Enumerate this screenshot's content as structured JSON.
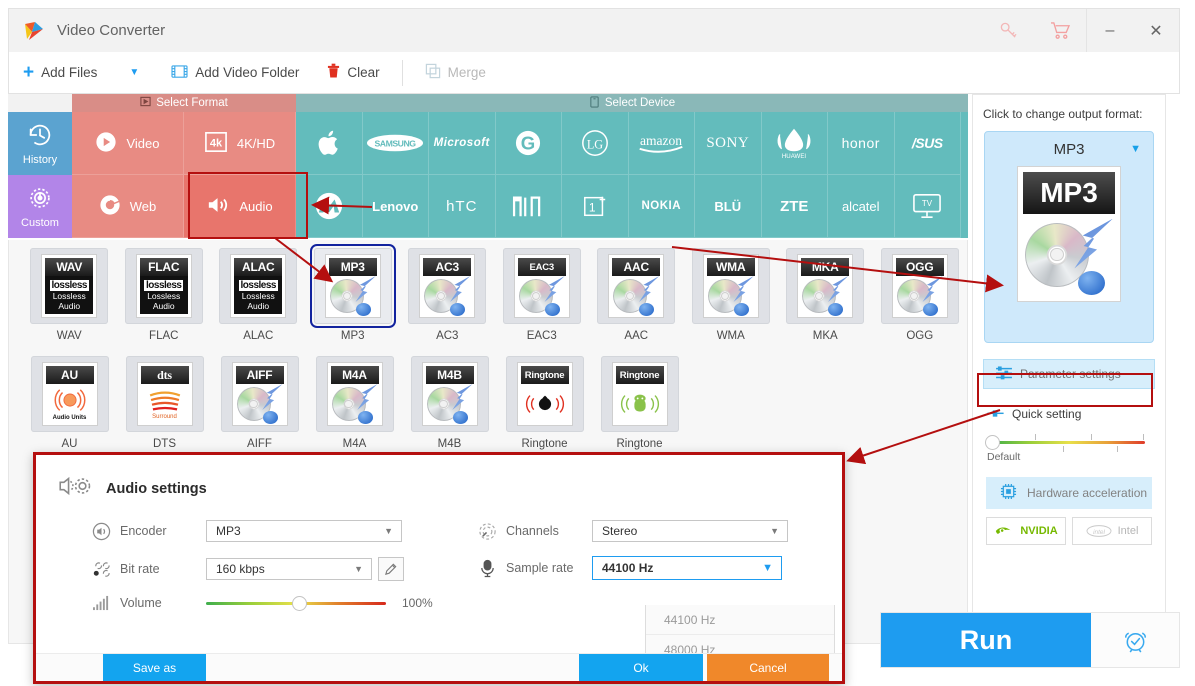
{
  "window": {
    "title": "Video Converter",
    "logo_icon": "app-logo-icon",
    "key_icon": "key-icon",
    "cart_icon": "cart-icon",
    "minimize": "–",
    "close": "✕"
  },
  "toolbar": {
    "add_files": "Add Files",
    "add_files_caret": "▼",
    "add_video_folder": "Add Video Folder",
    "clear": "Clear",
    "merge": "Merge"
  },
  "strip": {
    "select_format_header": "Select Format",
    "select_device_header": "Select Device",
    "side_tabs": [
      {
        "label": "History",
        "icon": "history-icon",
        "color": "#5ba3d0"
      },
      {
        "label": "Custom",
        "icon": "gear-icon",
        "color": "#b285e8"
      }
    ],
    "format_tabs": [
      {
        "label": "Video",
        "icon": "play-circle-icon",
        "selected": false
      },
      {
        "label": "4K/HD",
        "icon": "4k-icon",
        "selected": false
      },
      {
        "label": "Web",
        "icon": "chrome-icon",
        "selected": false
      },
      {
        "label": "Audio",
        "icon": "speaker-icon",
        "selected": true
      }
    ],
    "devices": [
      "Apple",
      "SAMSUNG",
      "Microsoft",
      "G",
      "LG",
      "amazon",
      "SONY",
      "HUAWEI",
      "honor",
      "/SUS",
      "Motorola",
      "Lenovo",
      "hTC",
      "MI",
      "1+",
      "NOKIA",
      "BLU",
      "ZTE",
      "alcatel",
      "TV"
    ]
  },
  "formats": {
    "row1": [
      {
        "name": "WAV",
        "badge": "WAV",
        "type": "lossless",
        "selected": false
      },
      {
        "name": "FLAC",
        "badge": "FLAC",
        "type": "lossless",
        "selected": false
      },
      {
        "name": "ALAC",
        "badge": "ALAC",
        "type": "lossless",
        "selected": false
      },
      {
        "name": "MP3",
        "badge": "MP3",
        "type": "cd",
        "selected": true
      },
      {
        "name": "AC3",
        "badge": "AC3",
        "type": "cd",
        "selected": false
      },
      {
        "name": "EAC3",
        "badge": "EAC3",
        "type": "cd",
        "selected": false
      },
      {
        "name": "AAC",
        "badge": "AAC",
        "type": "cd",
        "selected": false
      },
      {
        "name": "WMA",
        "badge": "WMA",
        "type": "cd",
        "selected": false
      },
      {
        "name": "MKA",
        "badge": "MKA",
        "type": "cd",
        "selected": false
      },
      {
        "name": "OGG",
        "badge": "OGG",
        "type": "cd",
        "selected": false
      }
    ],
    "row2": [
      {
        "name": "AU",
        "badge": "AU",
        "type": "au",
        "sub": "Audio Units"
      },
      {
        "name": "DTS",
        "badge": "dts",
        "type": "dts",
        "sub": "Surround"
      },
      {
        "name": "AIFF",
        "badge": "AIFF",
        "type": "cd",
        "sub": ""
      },
      {
        "name": "M4A",
        "badge": "M4A",
        "type": "cd",
        "sub": ""
      },
      {
        "name": "M4B",
        "badge": "M4B",
        "type": "cd",
        "sub": ""
      },
      {
        "name": "Ringtone",
        "badge": "Ringtone",
        "type": "apple",
        "sub": ""
      },
      {
        "name": "Ringtone",
        "badge": "Ringtone",
        "type": "android",
        "sub": ""
      }
    ],
    "lossless_word": "lossless",
    "lossless_line1": "Lossless",
    "lossless_line2": "Audio"
  },
  "right_panel": {
    "title": "Click to change output format:",
    "output_format": "MP3",
    "caret": "▼",
    "parameter_settings": "Parameter settings",
    "quick_setting": "Quick setting",
    "quick_setting_value": "Default",
    "hardware_acceleration": "Hardware acceleration",
    "gpu_nvidia": "NVIDIA",
    "gpu_intel": "Intel"
  },
  "run": {
    "label": "Run",
    "alarm_icon": "alarm-clock-icon"
  },
  "dialog": {
    "title": "Audio settings",
    "title_icon": "speaker-gear-icon",
    "fields": {
      "encoder": {
        "label": "Encoder",
        "value": "MP3",
        "icon": "speaker-round-icon"
      },
      "bitrate": {
        "label": "Bit rate",
        "value": "160 kbps",
        "icon": "bitrate-icon",
        "edit_icon": "pencil-icon"
      },
      "volume": {
        "label": "Volume",
        "value": "100%",
        "icon": "bars-icon"
      },
      "channels": {
        "label": "Channels",
        "value": "Stereo",
        "icon": "channels-icon"
      },
      "samplerate": {
        "label": "Sample rate",
        "value": "44100 Hz",
        "icon": "microphone-icon",
        "options": [
          "44100 Hz",
          "48000 Hz"
        ]
      }
    },
    "buttons": {
      "save_as": "Save as",
      "ok": "Ok",
      "cancel": "Cancel"
    }
  },
  "colors": {
    "accent_blue": "#1e9cf0",
    "format_tab": "#e88b83",
    "device_tab": "#63bcbc",
    "annotation_red": "#b40f0f",
    "selection_blue": "#12239e",
    "cancel_orange": "#f0882a"
  }
}
